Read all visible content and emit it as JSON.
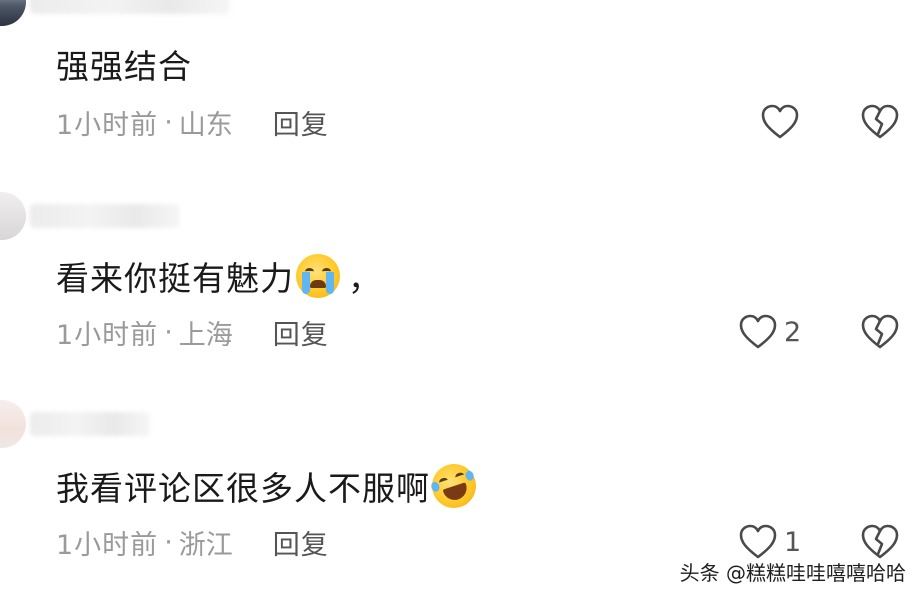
{
  "comments": [
    {
      "text": "强强结合",
      "time": "1小时前",
      "separator": "·",
      "location": "山东",
      "reply_label": "回复",
      "like_count": "",
      "has_emoji": false
    },
    {
      "text": "看来你挺有魅力",
      "emoji": "loudly-crying-face",
      "after_emoji": "，",
      "time": "1小时前",
      "separator": "·",
      "location": "上海",
      "reply_label": "回复",
      "like_count": "2",
      "has_emoji": true
    },
    {
      "text": "我看评论区很多人不服啊",
      "emoji": "rolling-on-the-floor-laughing",
      "time": "1小时前",
      "separator": "·",
      "location": "浙江",
      "reply_label": "回复",
      "like_count": "1",
      "has_emoji": true
    }
  ],
  "watermark": "头条 @糕糕哇哇嘻嘻哈哈",
  "colors": {
    "text": "#1a1a1a",
    "meta": "#9a9a9a",
    "reply": "#555555",
    "icon_stroke": "#4a4a4a",
    "background": "#ffffff"
  },
  "icons": {
    "like": "heart-outline-icon",
    "dislike": "broken-heart-icon"
  }
}
